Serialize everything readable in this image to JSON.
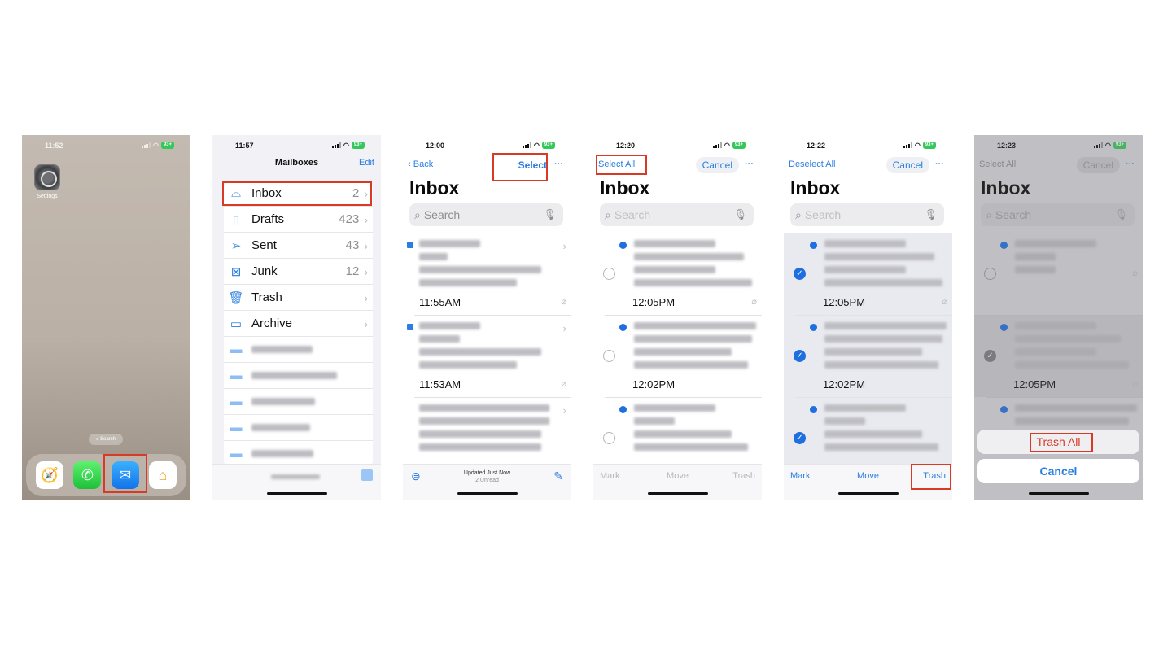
{
  "colors": {
    "accent": "#2a7de1",
    "highlight": "#d93a25",
    "battery": "#34c759",
    "destructive": "#d93a25"
  },
  "panels": [
    {
      "status": {
        "time": "11:52",
        "battery": "93+"
      },
      "apps": {
        "settings": "Settings"
      },
      "search_pill": "Search",
      "dock": [
        "safari-icon",
        "phone-icon",
        "mail-icon",
        "home-icon"
      ]
    },
    {
      "status": {
        "time": "11:57",
        "battery": "93+"
      },
      "header": {
        "title": "Mailboxes",
        "edit": "Edit"
      },
      "mailboxes": [
        {
          "name": "Inbox",
          "count": "2",
          "icon": "tray-icon"
        },
        {
          "name": "Drafts",
          "count": "423",
          "icon": "document-icon"
        },
        {
          "name": "Sent",
          "count": "43",
          "icon": "paperplane-icon"
        },
        {
          "name": "Junk",
          "count": "12",
          "icon": "junk-icon"
        },
        {
          "name": "Trash",
          "count": "",
          "icon": "trash-icon"
        },
        {
          "name": "Archive",
          "count": "",
          "icon": "archive-icon"
        }
      ]
    },
    {
      "status": {
        "time": "12:00",
        "battery": "93+"
      },
      "nav": {
        "back": "Back",
        "select": "Select",
        "more": "···"
      },
      "title": "Inbox",
      "search_placeholder": "Search",
      "messages": [
        {
          "time": "11:55AM"
        },
        {
          "time": "11:53AM"
        },
        {
          "time": ""
        }
      ],
      "footer": {
        "updated": "Updated Just Now",
        "unread": "2 Unread"
      }
    },
    {
      "status": {
        "time": "12:20",
        "battery": "93+"
      },
      "nav": {
        "select_all": "Select All",
        "cancel": "Cancel",
        "more": "···"
      },
      "title": "Inbox",
      "search_placeholder": "Search",
      "messages": [
        {
          "time": "12:05PM"
        },
        {
          "time": "12:02PM"
        },
        {
          "time": ""
        }
      ],
      "toolbar": {
        "mark": "Mark",
        "move": "Move",
        "trash": "Trash"
      }
    },
    {
      "status": {
        "time": "12:22",
        "battery": "93+"
      },
      "nav": {
        "deselect_all": "Deselect All",
        "cancel": "Cancel",
        "more": "···"
      },
      "title": "Inbox",
      "search_placeholder": "Search",
      "messages": [
        {
          "time": "12:05PM"
        },
        {
          "time": "12:02PM"
        },
        {
          "time": ""
        }
      ],
      "toolbar": {
        "mark": "Mark",
        "move": "Move",
        "trash": "Trash"
      }
    },
    {
      "status": {
        "time": "12:23",
        "battery": "93+"
      },
      "nav": {
        "select_all": "Select All",
        "cancel": "Cancel",
        "more": "···"
      },
      "title": "Inbox",
      "search_placeholder": "Search",
      "messages": [
        {
          "time": ""
        },
        {
          "time": "12:05PM"
        }
      ],
      "sheet": {
        "trash_all": "Trash All",
        "cancel": "Cancel"
      }
    }
  ]
}
